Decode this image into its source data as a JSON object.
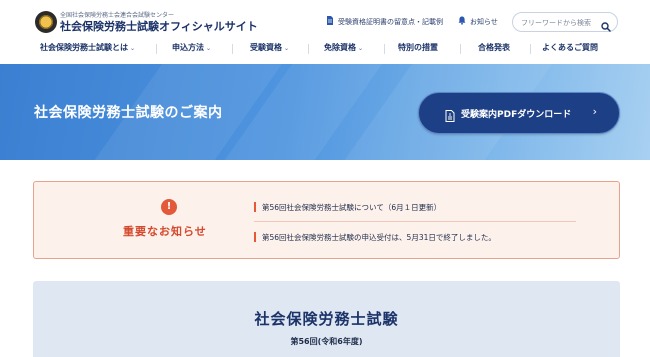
{
  "header": {
    "org_name": "全国社会保険労務士会連合会試験センター",
    "site_title": "社会保険労務士試験オフィシャルサイト",
    "links": [
      {
        "label": "受験資格証明書の留意点・記載例",
        "icon": "document-icon"
      },
      {
        "label": "お知らせ",
        "icon": "bell-icon"
      }
    ],
    "search": {
      "placeholder": "フリーワードから検索",
      "value": ""
    }
  },
  "nav": {
    "items": [
      {
        "label": "社会保険労務士試験とは",
        "has_dropdown": true
      },
      {
        "label": "申込方法",
        "has_dropdown": true
      },
      {
        "label": "受験資格",
        "has_dropdown": true
      },
      {
        "label": "免除資格",
        "has_dropdown": true
      },
      {
        "label": "特別の措置",
        "has_dropdown": false
      },
      {
        "label": "合格発表",
        "has_dropdown": false
      },
      {
        "label": "よくあるご質問",
        "has_dropdown": false
      }
    ]
  },
  "hero": {
    "title": "社会保険労務士試験のご案内",
    "pdf_button": "受験案内PDFダウンロード"
  },
  "notice": {
    "title": "重要なお知らせ",
    "items": [
      "第56回社会保険労務士試験について（6月１日更新）",
      "第56回社会保険労務士試験の申込受付は、5月31日で終了しました。"
    ]
  },
  "exam": {
    "title": "社会保険労務士試験",
    "round": "第56回(令和6年度)"
  },
  "colors": {
    "brand_navy": "#1b3368",
    "hero_blue": "#4f95df",
    "button_navy": "#1c3f86",
    "alert_red": "#e35a3a",
    "notice_bg": "#fdf1ec",
    "exam_bg": "#dfe7f3"
  }
}
